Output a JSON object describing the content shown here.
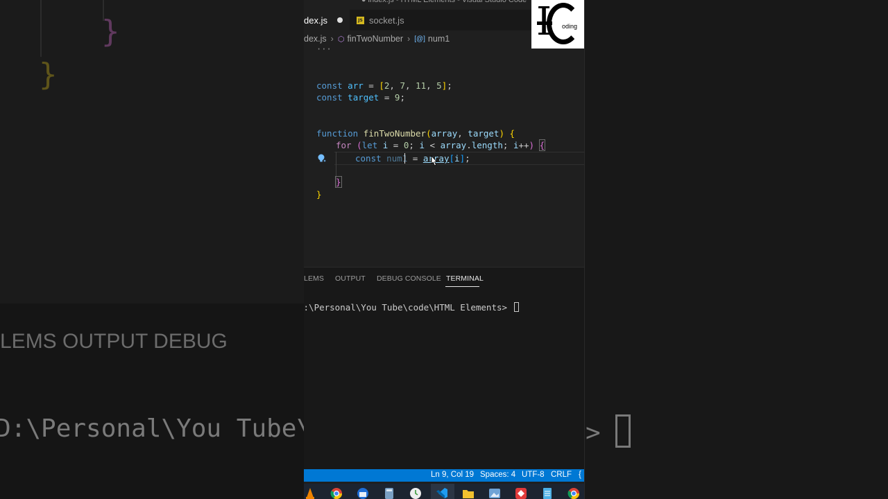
{
  "window": {
    "title": "● index.js - HTML Elements - Visual Studio Code"
  },
  "tabs": [
    {
      "label": "dex.js",
      "modified": true,
      "active": true
    },
    {
      "label": "socket.js",
      "icon": "js-file-icon",
      "active": false
    }
  ],
  "breadcrumb": {
    "file": "dex.js",
    "function": "finTwoNumber",
    "symbol": "num1"
  },
  "editor": {
    "ellipsis": "···",
    "lines": {
      "arr_kw": "const",
      "arr_name": "arr",
      "arr_eq": " = ",
      "arr_open": "[",
      "arr_v1": "2",
      "arr_v2": "7",
      "arr_v3": "11",
      "arr_v4": "5",
      "arr_close": "]",
      "target_kw": "const",
      "target_name": "target",
      "target_eq": " = ",
      "target_val": "9",
      "fn_kw": "function",
      "fn_name": "finTwoNumber",
      "fn_p1": "array",
      "fn_p2": "target",
      "for_kw": "for",
      "for_let": "let",
      "for_i": "i",
      "for_zero": "0",
      "for_i2": "i",
      "for_lt": " < ",
      "for_arr": "array",
      "for_len": "length",
      "for_i3": "i",
      "num_kw": "const",
      "num_name": "num1",
      "num_eq": " = ",
      "num_arr": "array",
      "num_i": "i"
    }
  },
  "panel": {
    "tabs": [
      "LEMS",
      "OUTPUT",
      "DEBUG CONSOLE",
      "TERMINAL"
    ],
    "active_tab": "TERMINAL",
    "terminal_prompt": "D:\\Personal\\You Tube\\code\\HTML Elements>"
  },
  "statusbar": {
    "position": "Ln 9, Col 19",
    "spaces": "Spaces: 4",
    "encoding": "UTF-8",
    "eol": "CRLF",
    "lang_icon": "{"
  },
  "background": {
    "tabs_text": "LEMS      OUTPUT      DEBUG",
    "path_text": "D:\\Personal\\You Tube\\"
  },
  "logo": {
    "letters": "HC",
    "suffix": "oding"
  },
  "taskbar": {
    "icons": [
      "vlc-icon",
      "chrome-icon",
      "thunderbird-icon",
      "calculator-icon",
      "clock-icon",
      "vscode-icon",
      "file-explorer-icon",
      "photos-icon",
      "anydesk-icon",
      "notepad-icon",
      "chrome-icon"
    ]
  },
  "colors": {
    "accent": "#0078d4",
    "editor_bg": "#1f1f1f",
    "keyword": "#569cd6",
    "control": "#c586c0",
    "function": "#dcdcaa",
    "variable": "#9cdcfe",
    "number": "#b5cea8"
  }
}
